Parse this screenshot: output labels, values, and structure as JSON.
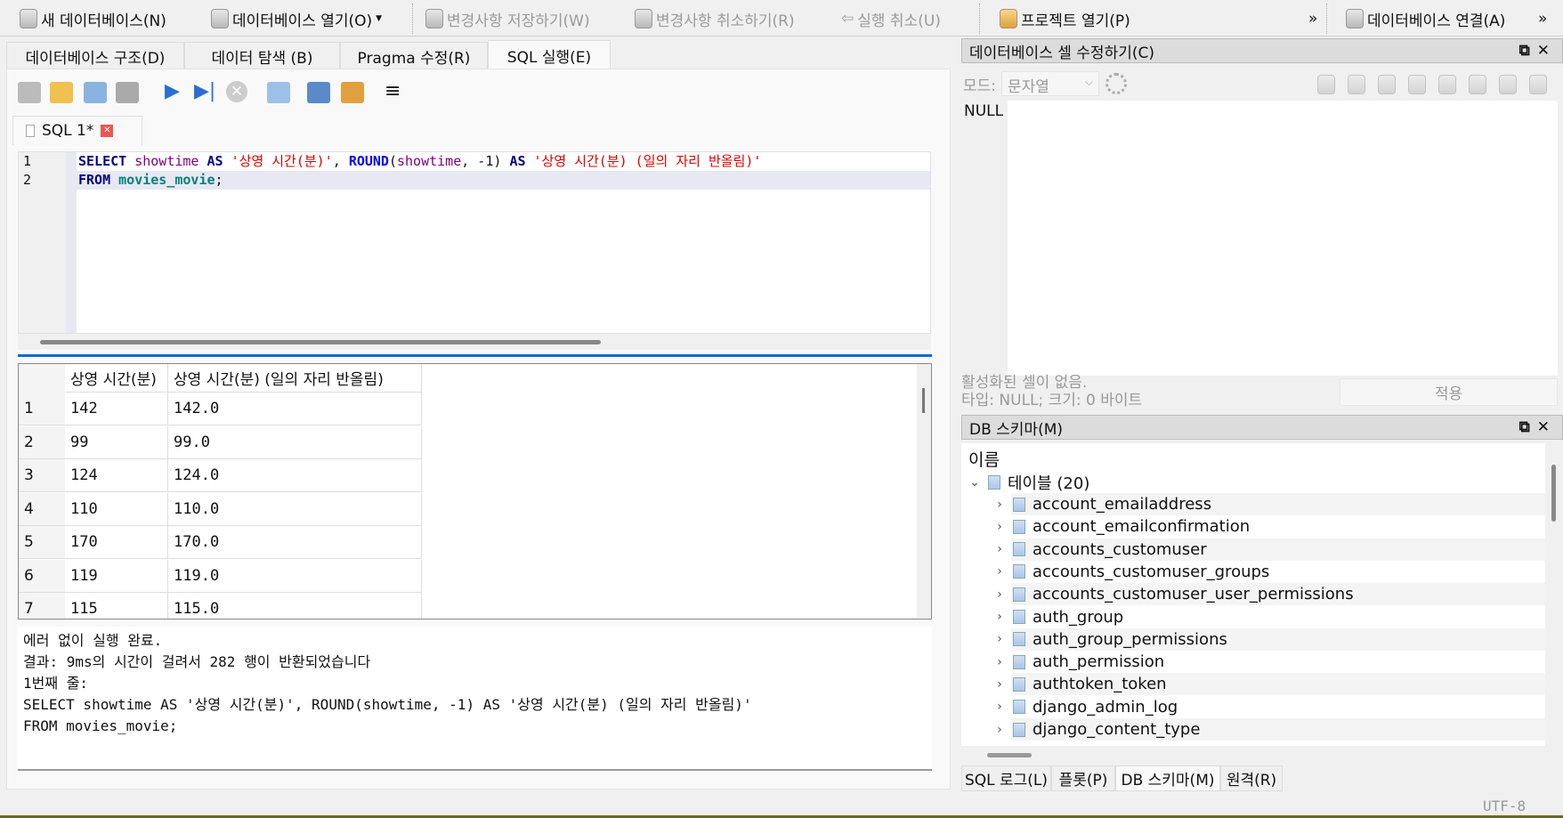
{
  "toolbar": {
    "new_db": "새 데이터베이스(N)",
    "open_db": "데이터베이스 열기(O)",
    "write_changes": "변경사항 저장하기(W)",
    "revert_changes": "변경사항 취소하기(R)",
    "undo": "실행 취소(U)",
    "open_project": "프로젝트 열기(P)",
    "attach_db": "데이터베이스 연결(A)",
    "overflow": "»"
  },
  "tabs": [
    "데이터베이스 구조(D)",
    "데이터 탐색 (B)",
    "Pragma 수정(R)",
    "SQL 실행(E)"
  ],
  "sql_tab": {
    "label": "SQL 1*"
  },
  "editor": {
    "line_numbers": [
      "1",
      "2"
    ]
  },
  "results": {
    "headers": [
      "상영 시간(분)",
      "상영 시간(분) (일의 자리 반올림)"
    ],
    "rows": [
      [
        "1",
        "142",
        "142.0"
      ],
      [
        "2",
        "99",
        "99.0"
      ],
      [
        "3",
        "124",
        "124.0"
      ],
      [
        "4",
        "110",
        "110.0"
      ],
      [
        "5",
        "170",
        "170.0"
      ],
      [
        "6",
        "119",
        "119.0"
      ],
      [
        "7",
        "115",
        "115.0"
      ]
    ]
  },
  "messages": [
    "에러 없이 실행 완료.",
    "결과: 9ms의 시간이 걸려서 282 행이 반환되었습니다",
    "1번째 줄:",
    "SELECT showtime AS '상영 시간(분)', ROUND(showtime, -1) AS '상영 시간(분) (일의 자리 반올림)'",
    "FROM movies_movie;"
  ],
  "cell_editor": {
    "title": "데이터베이스 셀 수정하기(C)",
    "mode_label": "모드:",
    "mode_value": "문자열",
    "value": "NULL",
    "status1": "활성화된 셀이 없음.",
    "status2": "타입: NULL; 크기: 0 바이트",
    "apply": "적용"
  },
  "schema": {
    "title": "DB 스키마(M)",
    "column_header": "이름",
    "group": "테이블 (20)",
    "tables": [
      "account_emailaddress",
      "account_emailconfirmation",
      "accounts_customuser",
      "accounts_customuser_groups",
      "accounts_customuser_user_permissions",
      "auth_group",
      "auth_group_permissions",
      "auth_permission",
      "authtoken_token",
      "django_admin_log",
      "django_content_type"
    ]
  },
  "bottom_tabs": [
    "SQL 로그(L)",
    "플롯(P)",
    "DB 스키마(M)",
    "원격(R)"
  ],
  "status": {
    "encoding": "UTF-8"
  }
}
